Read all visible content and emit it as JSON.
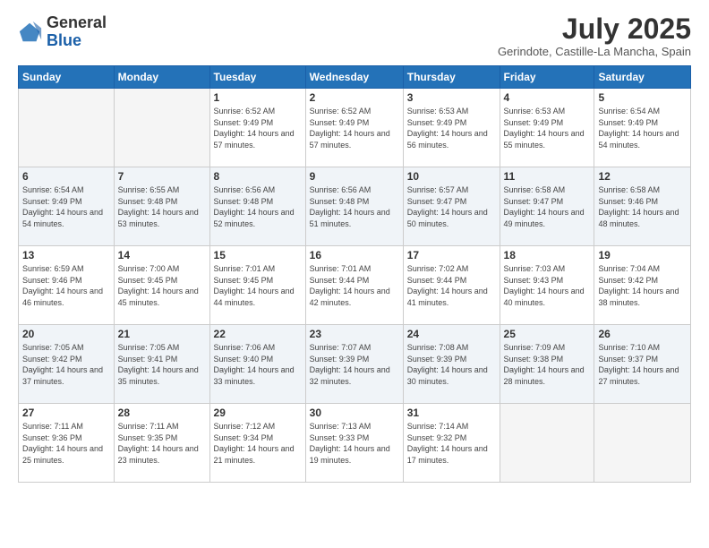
{
  "header": {
    "logo_general": "General",
    "logo_blue": "Blue",
    "month_title": "July 2025",
    "location": "Gerindote, Castille-La Mancha, Spain"
  },
  "weekdays": [
    "Sunday",
    "Monday",
    "Tuesday",
    "Wednesday",
    "Thursday",
    "Friday",
    "Saturday"
  ],
  "weeks": [
    {
      "alt": false,
      "days": [
        {
          "num": "",
          "info": ""
        },
        {
          "num": "",
          "info": ""
        },
        {
          "num": "1",
          "info": "Sunrise: 6:52 AM\nSunset: 9:49 PM\nDaylight: 14 hours and 57 minutes."
        },
        {
          "num": "2",
          "info": "Sunrise: 6:52 AM\nSunset: 9:49 PM\nDaylight: 14 hours and 57 minutes."
        },
        {
          "num": "3",
          "info": "Sunrise: 6:53 AM\nSunset: 9:49 PM\nDaylight: 14 hours and 56 minutes."
        },
        {
          "num": "4",
          "info": "Sunrise: 6:53 AM\nSunset: 9:49 PM\nDaylight: 14 hours and 55 minutes."
        },
        {
          "num": "5",
          "info": "Sunrise: 6:54 AM\nSunset: 9:49 PM\nDaylight: 14 hours and 54 minutes."
        }
      ]
    },
    {
      "alt": true,
      "days": [
        {
          "num": "6",
          "info": "Sunrise: 6:54 AM\nSunset: 9:49 PM\nDaylight: 14 hours and 54 minutes."
        },
        {
          "num": "7",
          "info": "Sunrise: 6:55 AM\nSunset: 9:48 PM\nDaylight: 14 hours and 53 minutes."
        },
        {
          "num": "8",
          "info": "Sunrise: 6:56 AM\nSunset: 9:48 PM\nDaylight: 14 hours and 52 minutes."
        },
        {
          "num": "9",
          "info": "Sunrise: 6:56 AM\nSunset: 9:48 PM\nDaylight: 14 hours and 51 minutes."
        },
        {
          "num": "10",
          "info": "Sunrise: 6:57 AM\nSunset: 9:47 PM\nDaylight: 14 hours and 50 minutes."
        },
        {
          "num": "11",
          "info": "Sunrise: 6:58 AM\nSunset: 9:47 PM\nDaylight: 14 hours and 49 minutes."
        },
        {
          "num": "12",
          "info": "Sunrise: 6:58 AM\nSunset: 9:46 PM\nDaylight: 14 hours and 48 minutes."
        }
      ]
    },
    {
      "alt": false,
      "days": [
        {
          "num": "13",
          "info": "Sunrise: 6:59 AM\nSunset: 9:46 PM\nDaylight: 14 hours and 46 minutes."
        },
        {
          "num": "14",
          "info": "Sunrise: 7:00 AM\nSunset: 9:45 PM\nDaylight: 14 hours and 45 minutes."
        },
        {
          "num": "15",
          "info": "Sunrise: 7:01 AM\nSunset: 9:45 PM\nDaylight: 14 hours and 44 minutes."
        },
        {
          "num": "16",
          "info": "Sunrise: 7:01 AM\nSunset: 9:44 PM\nDaylight: 14 hours and 42 minutes."
        },
        {
          "num": "17",
          "info": "Sunrise: 7:02 AM\nSunset: 9:44 PM\nDaylight: 14 hours and 41 minutes."
        },
        {
          "num": "18",
          "info": "Sunrise: 7:03 AM\nSunset: 9:43 PM\nDaylight: 14 hours and 40 minutes."
        },
        {
          "num": "19",
          "info": "Sunrise: 7:04 AM\nSunset: 9:42 PM\nDaylight: 14 hours and 38 minutes."
        }
      ]
    },
    {
      "alt": true,
      "days": [
        {
          "num": "20",
          "info": "Sunrise: 7:05 AM\nSunset: 9:42 PM\nDaylight: 14 hours and 37 minutes."
        },
        {
          "num": "21",
          "info": "Sunrise: 7:05 AM\nSunset: 9:41 PM\nDaylight: 14 hours and 35 minutes."
        },
        {
          "num": "22",
          "info": "Sunrise: 7:06 AM\nSunset: 9:40 PM\nDaylight: 14 hours and 33 minutes."
        },
        {
          "num": "23",
          "info": "Sunrise: 7:07 AM\nSunset: 9:39 PM\nDaylight: 14 hours and 32 minutes."
        },
        {
          "num": "24",
          "info": "Sunrise: 7:08 AM\nSunset: 9:39 PM\nDaylight: 14 hours and 30 minutes."
        },
        {
          "num": "25",
          "info": "Sunrise: 7:09 AM\nSunset: 9:38 PM\nDaylight: 14 hours and 28 minutes."
        },
        {
          "num": "26",
          "info": "Sunrise: 7:10 AM\nSunset: 9:37 PM\nDaylight: 14 hours and 27 minutes."
        }
      ]
    },
    {
      "alt": false,
      "days": [
        {
          "num": "27",
          "info": "Sunrise: 7:11 AM\nSunset: 9:36 PM\nDaylight: 14 hours and 25 minutes."
        },
        {
          "num": "28",
          "info": "Sunrise: 7:11 AM\nSunset: 9:35 PM\nDaylight: 14 hours and 23 minutes."
        },
        {
          "num": "29",
          "info": "Sunrise: 7:12 AM\nSunset: 9:34 PM\nDaylight: 14 hours and 21 minutes."
        },
        {
          "num": "30",
          "info": "Sunrise: 7:13 AM\nSunset: 9:33 PM\nDaylight: 14 hours and 19 minutes."
        },
        {
          "num": "31",
          "info": "Sunrise: 7:14 AM\nSunset: 9:32 PM\nDaylight: 14 hours and 17 minutes."
        },
        {
          "num": "",
          "info": ""
        },
        {
          "num": "",
          "info": ""
        }
      ]
    }
  ]
}
